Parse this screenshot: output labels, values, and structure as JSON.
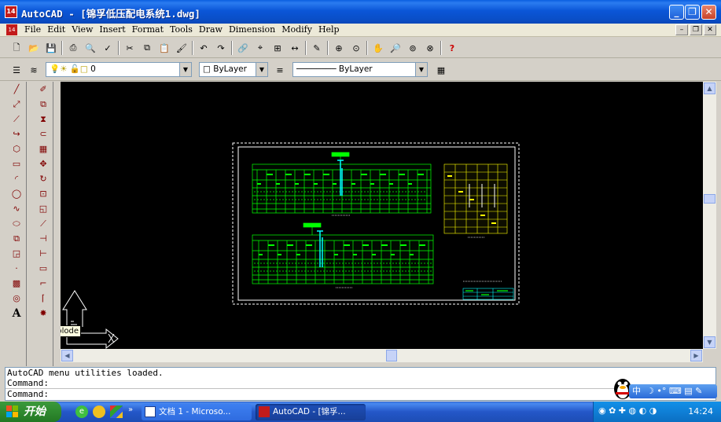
{
  "window": {
    "title": "AutoCAD - [锦孚低压配电系统1.dwg]",
    "app_icon_text": "14"
  },
  "menu": {
    "items": [
      "File",
      "Edit",
      "View",
      "Insert",
      "Format",
      "Tools",
      "Draw",
      "Dimension",
      "Modify",
      "Help"
    ]
  },
  "layer_toolbar": {
    "layer_value": "0",
    "color_value": "ByLayer",
    "linetype_value": "ByLayer"
  },
  "command": {
    "lines": [
      "AutoCAD menu utilities loaded.",
      "Command:",
      "Command:"
    ]
  },
  "tooltip": {
    "text": "Explode"
  },
  "taskbar": {
    "start_label": "开始",
    "tasks": [
      "文档 1 - Microso...",
      "AutoCAD - [锦孚..."
    ],
    "ime_label": "中",
    "clock": "14:24"
  },
  "colors": {
    "titlebar": "#0b56d8",
    "drawing_bg": "#000000",
    "drawing_green": "#00ff00",
    "drawing_yellow": "#ffff00",
    "drawing_cyan": "#00ffff"
  }
}
